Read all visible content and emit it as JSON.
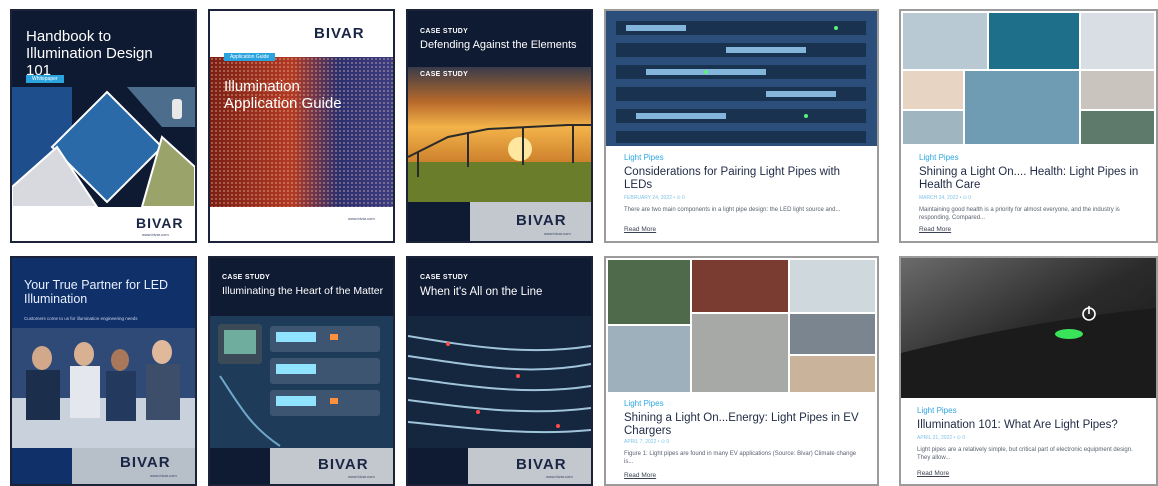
{
  "cards": {
    "handbook": {
      "title": "Handbook to Illumination Design 101",
      "badge": "Whitepaper",
      "logo": "BIVAR",
      "url": "www.bivar.com"
    },
    "guide": {
      "logo": "BIVAR",
      "badge": "Application Guide",
      "title": "Illumination Application Guide",
      "url": "www.bivar.com"
    },
    "elements": {
      "eyebrow": "CASE STUDY",
      "title": "Defending Against the Elements",
      "art_eyebrow": "CASE STUDY",
      "logo": "BIVAR",
      "url": "www.bivar.com"
    },
    "partner": {
      "title": "Your True Partner for LED Illumination",
      "subtitle": "Customers come to us for illumination engineering needs",
      "logo": "BIVAR",
      "url": "www.bivar.com"
    },
    "heart": {
      "eyebrow": "CASE STUDY",
      "title": "Illuminating the Heart of the Matter",
      "logo": "BIVAR",
      "url": "www.bivar.com"
    },
    "line": {
      "eyebrow": "CASE STUDY",
      "title": "When it's All on the Line",
      "logo": "BIVAR",
      "url": "www.bivar.com"
    }
  },
  "articles": [
    {
      "category": "Light Pipes",
      "title": "Considerations for Pairing Light Pipes with LEDs",
      "meta": "FEBRUARY 24, 2022  •  ⊙ 0",
      "excerpt": "There are two main components in a light pipe design: the LED light source and...",
      "read_more": "Read More"
    },
    {
      "category": "Light Pipes",
      "title": "Shining a Light On.... Health: Light Pipes in Health Care",
      "meta": "MARCH 24, 2022  •  ⊙ 0",
      "excerpt": "Maintaining good health is a priority for almost everyone, and the industry is responding. Compared...",
      "read_more": "Read More"
    },
    {
      "category": "Light Pipes",
      "title": "Shining a Light On...Energy: Light Pipes in EV Chargers",
      "meta": "APRIL 7, 2022  •  ⊙ 0",
      "excerpt": "Figure 1: Light pipes are found in many EV applications (Source: Bivar) Climate change is...",
      "read_more": "Read More"
    },
    {
      "category": "Light Pipes",
      "title": "Illumination 101: What Are Light Pipes?",
      "meta": "APRIL 21, 2022  •  ⊙ 0",
      "excerpt": "Light pipes are a relatively simple, but critical part of electronic equipment design. They allow...",
      "read_more": "Read More"
    }
  ],
  "colors": {
    "navy": "#0f1a33",
    "accent": "#2aa3de",
    "title": "#1f2a44"
  }
}
